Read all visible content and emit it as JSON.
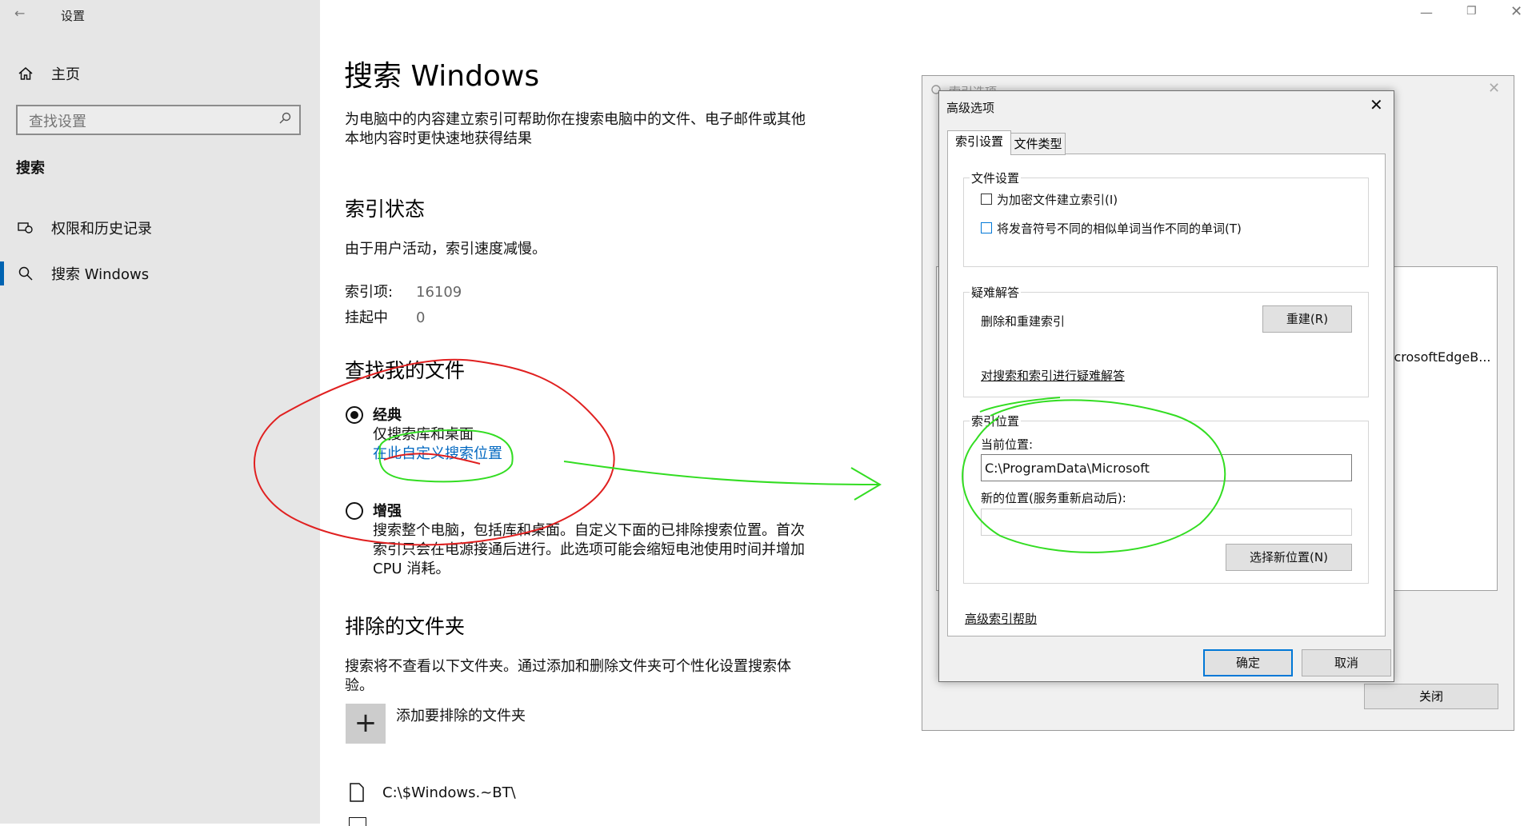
{
  "window": {
    "title": "设置",
    "back_icon": "←",
    "min_icon": "—",
    "max_icon": "❐",
    "close_icon": "✕"
  },
  "sidebar": {
    "home_label": "主页",
    "search_placeholder": "查找设置",
    "section_title": "搜索",
    "items": [
      {
        "label": "权限和历史记录",
        "icon": "permissions-icon"
      },
      {
        "label": "搜索 Windows",
        "icon": "search-icon",
        "active": true
      }
    ]
  },
  "main": {
    "title": "搜索 Windows",
    "intro": [
      "为电脑中的内容建立索引可帮助你在搜索电脑中的文件、电子邮件或其他",
      "本地内容时更快速地获得结果"
    ],
    "index_status": {
      "heading": "索引状态",
      "message": "由于用户活动，索引速度减慢。",
      "indexed_label": "索引项:",
      "indexed_value": "16109",
      "pending_label": "挂起中",
      "pending_value": "0"
    },
    "find_files": {
      "heading": "查找我的文件",
      "classic_label": "经典",
      "classic_desc": "仅搜索库和桌面",
      "classic_link": "在此自定义搜索位置",
      "enhanced_label": "增强",
      "enhanced_desc": [
        "搜索整个电脑，包括库和桌面。自定义下面的已排除搜索位置。首次",
        "索引只会在电源接通后进行。此选项可能会缩短电池使用时间并增加",
        "CPU 消耗。"
      ]
    },
    "excluded": {
      "heading": "排除的文件夹",
      "desc": [
        "搜索将不查看以下文件夹。通过添加和删除文件夹可个性化设置搜索体",
        "验。"
      ],
      "add_label": "添加要排除的文件夹",
      "folder": "C:\\$Windows.~BT\\"
    }
  },
  "index_options_window": {
    "title": "索引选项",
    "list_item": "icrosoftEdgeB...",
    "close_button": "关闭"
  },
  "advanced_dialog": {
    "title": "高级选项",
    "tabs": [
      "索引设置",
      "文件类型"
    ],
    "file_settings": {
      "label": "文件设置",
      "encrypt": "为加密文件建立索引(I)",
      "diacritics": "将发音符号不同的相似单词当作不同的单词(T)"
    },
    "troubleshoot": {
      "label": "疑难解答",
      "text": "删除和重建索引",
      "rebuild_button": "重建(R)",
      "link": "对搜索和索引进行疑难解答"
    },
    "index_location": {
      "label": "索引位置",
      "current_label": "当前位置:",
      "current_value": "C:\\ProgramData\\Microsoft",
      "new_label": "新的位置(服务重新启动后):",
      "new_value": "",
      "select_button": "选择新位置(N)"
    },
    "help_link": "高级索引帮助",
    "ok": "确定",
    "cancel": "取消"
  },
  "annotation_colors": {
    "red": "#e02020",
    "green": "#33dd22",
    "accent": "#0063b1",
    "link": "#0067c0"
  }
}
